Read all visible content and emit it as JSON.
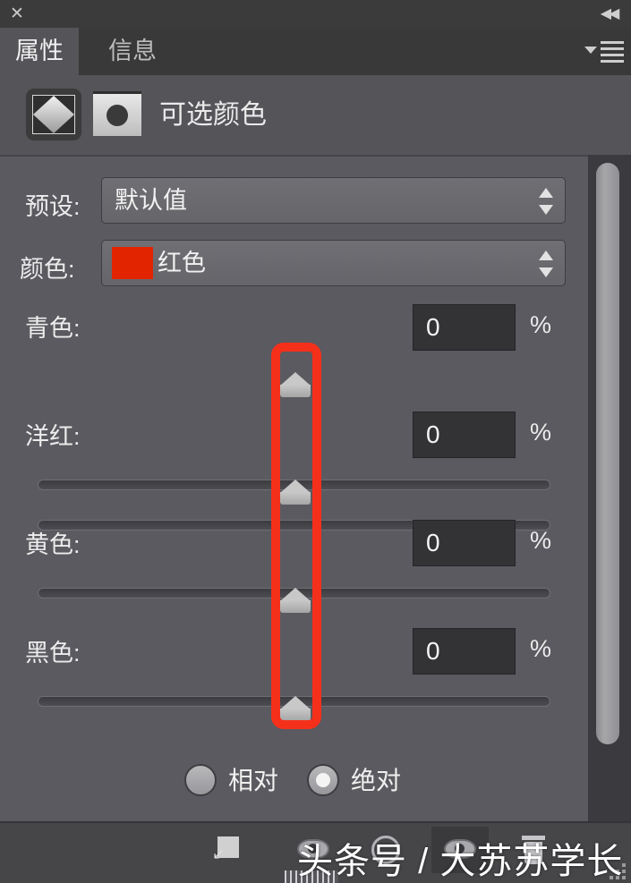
{
  "titlebar": {
    "close_icon": "close-x-icon",
    "collapse_icon": "collapse-double-chevron-icon",
    "close_label": "✕",
    "collapse_label": "◀◀"
  },
  "tabs": [
    {
      "label": "属性",
      "active": true
    },
    {
      "label": "信息",
      "active": false
    }
  ],
  "panel_menu": {
    "icon": "panel-menu-hamburger-icon"
  },
  "adjustment_header": {
    "title": "可选颜色",
    "layer_icon": "selective-color-adjustment-icon",
    "mask_icon": "layer-mask-thumbnail-icon"
  },
  "preset_row": {
    "label": "预设:",
    "value": "默认值"
  },
  "color_row": {
    "label": "颜色:",
    "value": "红色",
    "swatch_color": "#e32400"
  },
  "sliders": [
    {
      "label": "青色:",
      "value": "0",
      "unit": "%",
      "position_pct": 50
    },
    {
      "label": "洋红:",
      "value": "0",
      "unit": "%",
      "position_pct": 50
    },
    {
      "label": "黄色:",
      "value": "0",
      "unit": "%",
      "position_pct": 50
    },
    {
      "label": "黑色:",
      "value": "0",
      "unit": "%",
      "position_pct": 50
    }
  ],
  "method_options": [
    {
      "label": "相对",
      "checked": false
    },
    {
      "label": "绝对",
      "checked": true
    }
  ],
  "annotation": {
    "color": "#f4301b",
    "shape": "rounded-rectangle-highlight"
  },
  "bottom_toolbar": {
    "clip_icon": "clip-to-layer-icon",
    "view_previous_icon": "view-previous-state-eye-icon",
    "reset_icon": "reset-adjustment-icon",
    "toggle_visibility_icon": "toggle-layer-visibility-eye-icon",
    "delete_icon": "delete-adjustment-layer-icon",
    "resize_grip_icon": "resize-grip-icon"
  },
  "watermark": {
    "text": "头条号 / 大苏苏学长"
  },
  "scrollbar": {
    "orientation": "vertical"
  }
}
